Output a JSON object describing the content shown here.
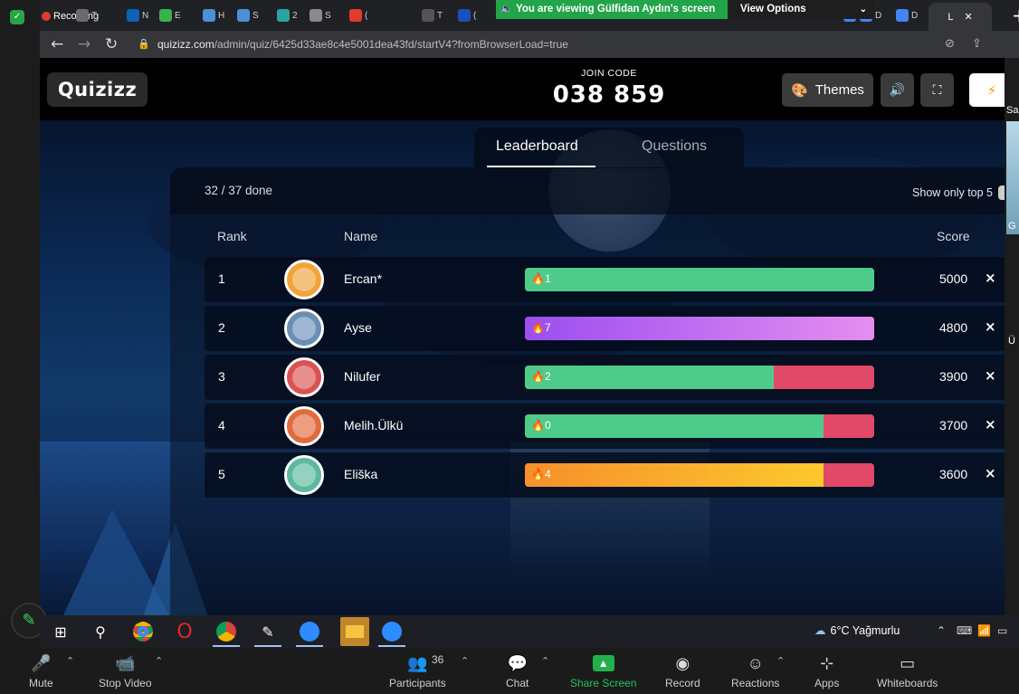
{
  "browser": {
    "recording_label": "Recording",
    "viewing_banner": "You are viewing Gülfidan Aydın's screen",
    "view_options": "View Options",
    "tabs": [
      {
        "letter": "T",
        "color": "#6b6b6b"
      },
      {
        "letter": "N",
        "color": "#0f62b7"
      },
      {
        "letter": "E",
        "color": "#38b24a"
      },
      {
        "letter": "H",
        "color": "#4b8fd6"
      },
      {
        "letter": "S",
        "color": "#4b8fd6"
      },
      {
        "letter": "2",
        "color": "#2aa3a3"
      },
      {
        "letter": "S",
        "color": "#8a8a8a"
      },
      {
        "letter": "(",
        "color": "#e33a2c"
      },
      {
        "letter": "T",
        "color": "#555555"
      },
      {
        "letter": "(",
        "color": "#1a4fbf"
      },
      {
        "letter": "F",
        "color": "#4285f4"
      },
      {
        "letter": "D",
        "color": "#4285f4"
      },
      {
        "letter": "D",
        "color": "#4285f4"
      }
    ],
    "active_tab_letter": "L",
    "url_host": "quizizz.com",
    "url_path": "/admin/quiz/6425d33ae8c4e5001dea43fd/startV4?fromBrowserLoad=true"
  },
  "quizizz": {
    "logo": "Quizizz",
    "join_label": "JOIN CODE",
    "join_code": "038 859",
    "themes_label": "Themes",
    "tabs": {
      "leaderboard": "Leaderboard",
      "questions": "Questions"
    },
    "progress_text": "32 / 37 done",
    "show_top_label": "Show only top 5",
    "columns": {
      "rank": "Rank",
      "name": "Name",
      "score": "Score"
    },
    "players": [
      {
        "rank": "1",
        "name": "Ercan*",
        "streak": "1",
        "score": "5000",
        "correct_fraction": 1.0,
        "bar_color": "#4ecb8b",
        "avatar_color": "#f2a33a"
      },
      {
        "rank": "2",
        "name": "Ayse",
        "streak": "7",
        "score": "4800",
        "correct_fraction": 1.0,
        "bar_color": "linear-gradient(90deg,#9b4ef0,#e48ef0)",
        "avatar_color": "#6a8fb6"
      },
      {
        "rank": "3",
        "name": "Nilufer",
        "streak": "2",
        "score": "3900",
        "correct_fraction": 0.713,
        "bar_color": "#4ecb8b",
        "avatar_color": "#d9534f"
      },
      {
        "rank": "4",
        "name": "Melih.Ülkü",
        "streak": "0",
        "score": "3700",
        "correct_fraction": 0.855,
        "bar_color": "#4ecb8b",
        "avatar_color": "#e06b3c"
      },
      {
        "rank": "5",
        "name": "Eliška",
        "streak": "4",
        "score": "3600",
        "correct_fraction": 0.855,
        "bar_color": "linear-gradient(90deg,#f6902b,#fcc92e)",
        "avatar_color": "#5bb9a0"
      }
    ],
    "remove_symbol": "×"
  },
  "side_panel": {
    "p1": "Sa",
    "p2": "G",
    "p3": "Ü"
  },
  "taskbar": {
    "weather": "6°C  Yağmurlu"
  },
  "zoom": {
    "mute": "Mute",
    "stop_video": "Stop Video",
    "participants": "Participants",
    "participants_count": "36",
    "chat": "Chat",
    "share_screen": "Share Screen",
    "record": "Record",
    "reactions": "Reactions",
    "apps": "Apps",
    "whiteboards": "Whiteboards"
  },
  "colors": {
    "quizizz_header": "#000000",
    "wrong_bar": "#e24868",
    "zoom_green": "#23b04a"
  }
}
